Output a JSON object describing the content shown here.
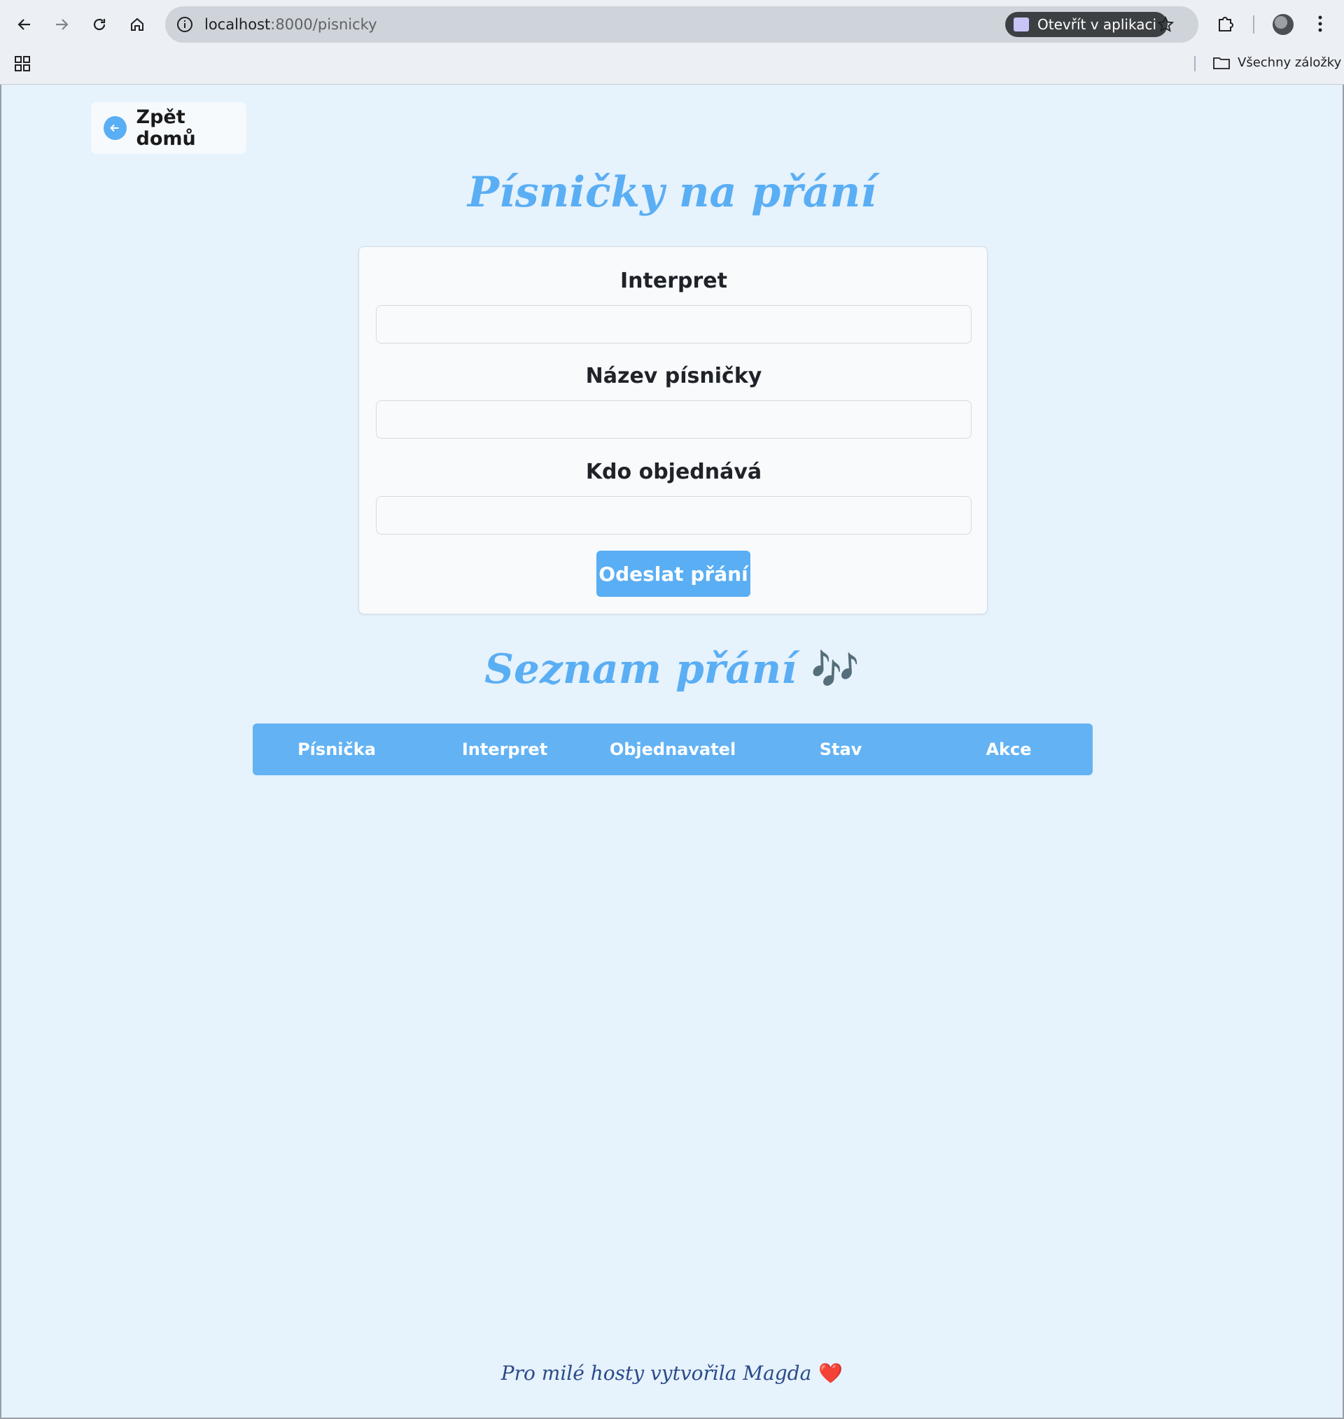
{
  "browser": {
    "url_host": "localhost",
    "url_path": ":8000/pisnicky",
    "open_app_label": "Otevřít v aplikaci",
    "bookmarks_label": "Všechny záložky"
  },
  "page": {
    "back_label": "Zpět domů",
    "title": "Písničky na přání",
    "form": {
      "artist_label": "Interpret",
      "artist_value": "",
      "song_label": "Název písničky",
      "song_value": "",
      "requester_label": "Kdo objednává",
      "requester_value": "",
      "submit_label": "Odeslat přání"
    },
    "list_title": "Seznam přání",
    "list_icon": "🎶",
    "table": {
      "columns": [
        "Písnička",
        "Interpret",
        "Objednavatel",
        "Stav",
        "Akce"
      ],
      "rows": []
    },
    "footer_text": "Pro milé hosty vytvořila Magda",
    "footer_icon": "❤️"
  },
  "colors": {
    "accent": "#5aaef4",
    "background": "#e6f2fc",
    "table_header": "#63b3f4"
  }
}
